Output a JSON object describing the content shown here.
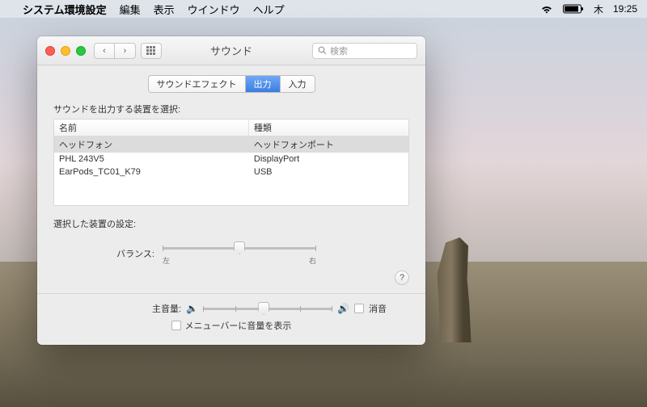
{
  "menubar": {
    "app": "システム環境設定",
    "items": [
      "編集",
      "表示",
      "ウインドウ",
      "ヘルプ"
    ],
    "day": "木",
    "time": "19:25"
  },
  "window": {
    "title": "サウンド",
    "search_placeholder": "検索",
    "tabs": [
      "サウンドエフェクト",
      "出力",
      "入力"
    ],
    "active_tab": 1,
    "section_label": "サウンドを出力する装置を選択:",
    "columns": [
      "名前",
      "種類"
    ],
    "devices": [
      {
        "name": "ヘッドフォン",
        "type": "ヘッドフォンポート",
        "selected": true
      },
      {
        "name": "PHL 243V5",
        "type": "DisplayPort",
        "selected": false
      },
      {
        "name": "EarPods_TC01_K79",
        "type": "USB",
        "selected": false
      }
    ],
    "settings_label": "選択した装置の設定:",
    "balance_label": "バランス:",
    "balance_left": "左",
    "balance_right": "右",
    "volume_label": "主音量:",
    "mute_label": "消音",
    "menu_show_label": "メニューバーに音量を表示",
    "help": "?"
  }
}
